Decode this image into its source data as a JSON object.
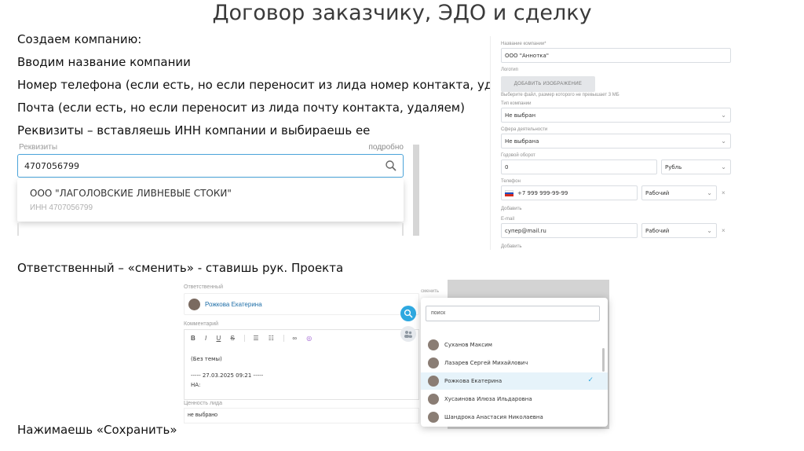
{
  "title": "Договор заказчику, ЭДО и сделку",
  "bullets": {
    "b1": "Создаем компанию:",
    "b2": "Вводим название компании",
    "b3": "Номер телефона (если есть, но если переносит из лида номер контакта, удаляем)",
    "b4": "Почта (если есть, но если переносит из лида почту контакта, удаляем)",
    "b5": "Реквизиты – вставляешь ИНН компании и выбираешь ее",
    "b6": "Ответственный – «сменить» - ставишь рук. Проекта",
    "b7": "Нажимаешь «Сохранить»"
  },
  "requisites": {
    "label": "Реквизиты",
    "link": "подробно",
    "input_value": "4707056799",
    "suggestion_name": "ООО \"ЛАГОЛОВСКИЕ ЛИВНЕВЫЕ СТОКИ\"",
    "suggestion_inn": "ИНН 4707056799"
  },
  "company_form": {
    "name_label": "Название компании*",
    "name_value": "ООО \"Аннотка\"",
    "logo_label": "Логотип",
    "logo_button": "ДОБАВИТЬ ИЗОБРАЖЕНИЕ",
    "logo_hint": "Выберите файл, размер которого не превышает 3 МБ",
    "type_label": "Тип компании",
    "type_value": "Не выбран",
    "sphere_label": "Сфера деятельности",
    "sphere_value": "Не выбрана",
    "turnover_label": "Годовой оборот",
    "turnover_value": "0",
    "currency_value": "Рубль",
    "phone_label": "Телефон",
    "phone_value": "+7 999 999-99-99",
    "phone_type": "Рабочий",
    "add_label": "Добавить",
    "email_label": "E-mail",
    "email_value": "супер@mail.ru",
    "email_type": "Рабочий",
    "add_label2": "Добавить"
  },
  "responsible": {
    "label": "Ответственный",
    "person": "Рожкова Екатерина",
    "change": "сменить",
    "comment_label": "Комментарий",
    "toolbar": [
      "B",
      "I",
      "U",
      "S"
    ],
    "subject": "(Без темы)",
    "forwarded": "----- 27.03.2025 09:21 -----",
    "to": "НА:",
    "value_label": "Ценность лида",
    "value": "не выбрано",
    "search_placeholder": "поиск",
    "list": [
      {
        "name": "Суханов Максим",
        "selected": false
      },
      {
        "name": "Лазарев Сергей Михайлович",
        "selected": false
      },
      {
        "name": "Рожкова Екатерина",
        "selected": true
      },
      {
        "name": "Хусаинова Илюза Ильдаровна",
        "selected": false
      },
      {
        "name": "Шандрока Анастасия Николаевна",
        "selected": false
      }
    ]
  },
  "colors": {
    "accent": "#2ea8e0",
    "link": "#1f6fa8"
  }
}
